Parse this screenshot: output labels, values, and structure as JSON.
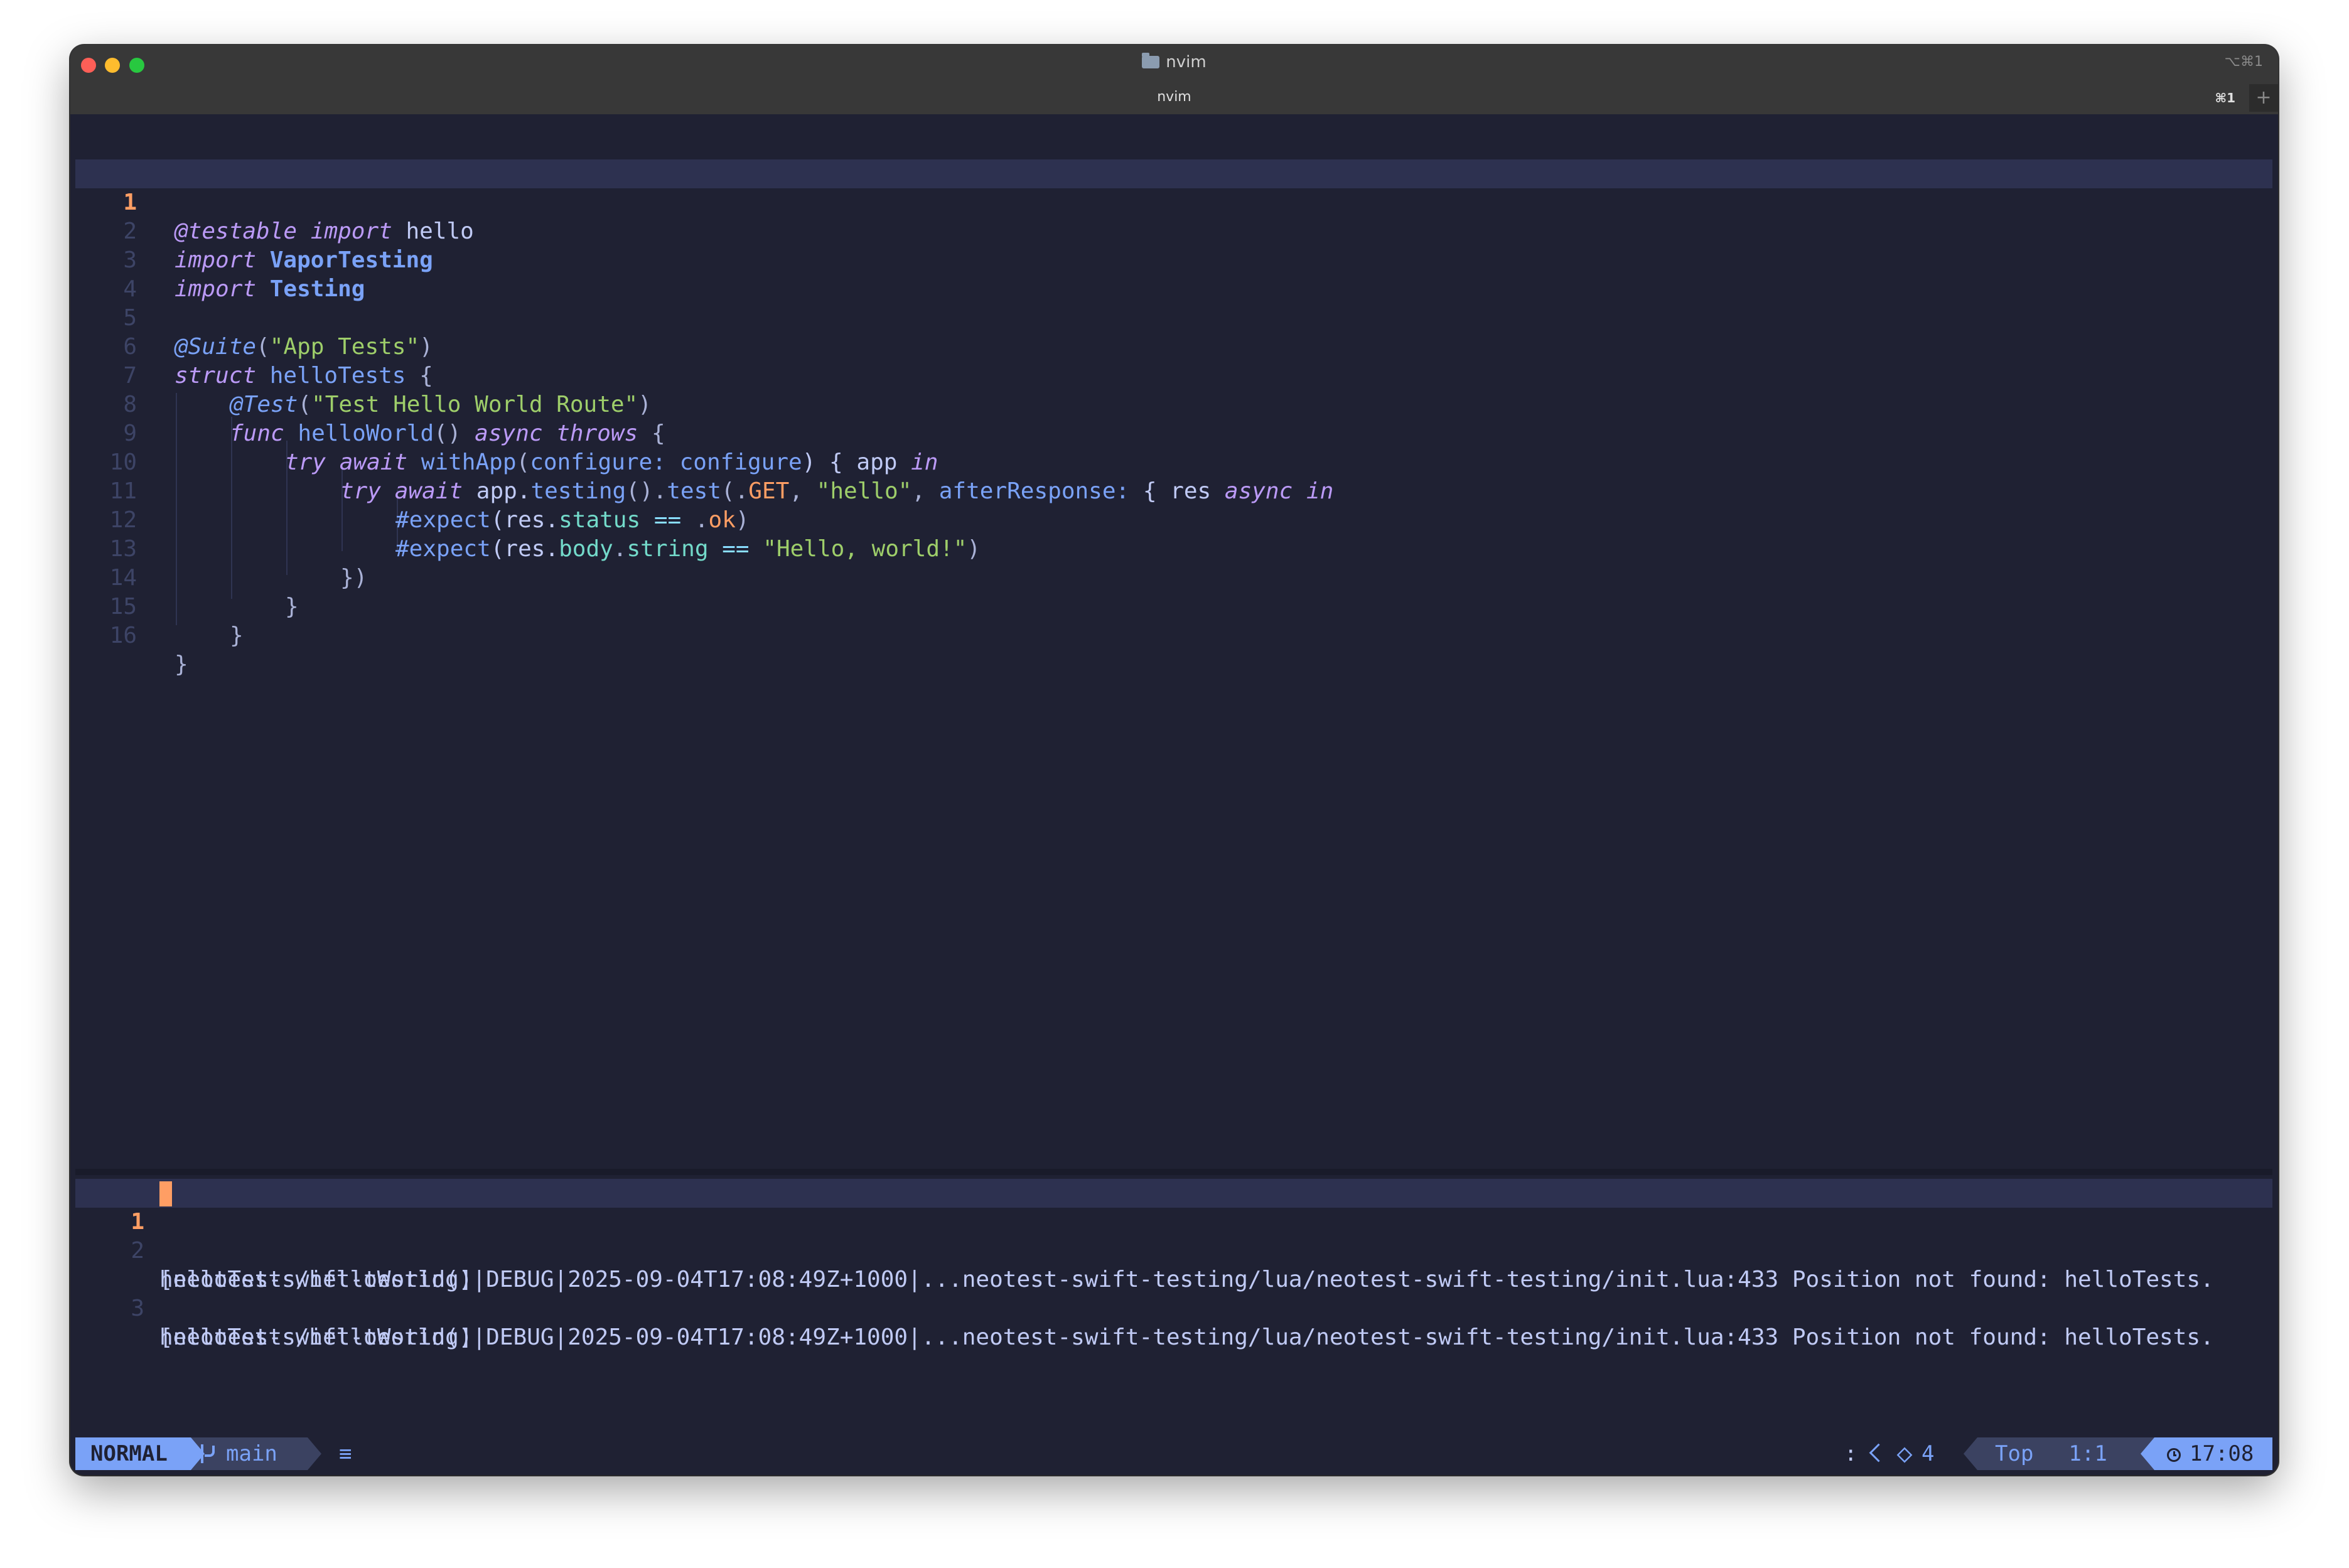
{
  "window": {
    "title": "nvim",
    "shortcut_top": "⌥⌘1",
    "tab": {
      "label": "nvim",
      "shortcut": "⌘1",
      "new_tab": "+"
    }
  },
  "editor": {
    "lines": [
      {
        "num": "1",
        "current": true
      },
      {
        "num": "2"
      },
      {
        "num": "3"
      },
      {
        "num": "4"
      },
      {
        "num": "5"
      },
      {
        "num": "6"
      },
      {
        "num": "7"
      },
      {
        "num": "8"
      },
      {
        "num": "9"
      },
      {
        "num": "10"
      },
      {
        "num": "11"
      },
      {
        "num": "12"
      },
      {
        "num": "13"
      },
      {
        "num": "14"
      },
      {
        "num": "15"
      },
      {
        "num": "16"
      }
    ],
    "tokens": {
      "l1": [
        "@testable",
        " ",
        "import",
        " hello"
      ],
      "l2": [
        "import",
        " ",
        "VaporTesting"
      ],
      "l3": [
        "import",
        " ",
        "Testing"
      ],
      "l5": [
        "@Suite",
        "(",
        "\"App Tests\"",
        ")"
      ],
      "l6": [
        "struct",
        " ",
        "helloTests",
        " {"
      ],
      "l7": [
        "@Test",
        "(",
        "\"Test Hello World Route\"",
        ")"
      ],
      "l8": [
        "func",
        " ",
        "helloWorld",
        "() ",
        "async",
        " ",
        "throws",
        " {"
      ],
      "l9": [
        "try",
        " ",
        "await",
        " ",
        "withApp",
        "(",
        "configure:",
        " ",
        "configure",
        ") { app ",
        "in"
      ],
      "l10": [
        "try",
        " ",
        "await",
        " app.",
        "testing",
        "().",
        "test",
        "(.",
        "GET",
        ", ",
        "\"hello\"",
        ", ",
        "afterResponse:",
        " { res ",
        "async",
        " ",
        "in"
      ],
      "l11": [
        "#expect",
        "(res.",
        "status",
        " ",
        "==",
        " .",
        "ok",
        ")"
      ],
      "l12": [
        "#expect",
        "(res.",
        "body",
        ".",
        "string",
        " ",
        "==",
        " ",
        "\"Hello, world!\"",
        ")"
      ],
      "l13": [
        "})"
      ],
      "l14": [
        "}"
      ],
      "l15": [
        "}"
      ],
      "l16": [
        "}"
      ]
    }
  },
  "log": {
    "lines": [
      {
        "num": "1",
        "text": "",
        "current": true
      },
      {
        "num": "2",
        "text": "[neotest-swift-testing]|DEBUG|2025-09-04T17:08:49Z+1000|...neotest-swift-testing/lua/neotest-swift-testing/init.lua:433 Position not found: helloTests.",
        "wrap": "helloTests/helloWorld()"
      },
      {
        "num": "3",
        "text": "[neotest-swift-testing]|DEBUG|2025-09-04T17:08:49Z+1000|...neotest-swift-testing/lua/neotest-swift-testing/init.lua:433 Position not found: helloTests.",
        "wrap": "helloTests/helloWorld()"
      }
    ]
  },
  "statusline": {
    "mode": "NORMAL",
    "branch": "main",
    "lines_icon": "≡",
    "colon": ":",
    "lsp_count": "4",
    "position": "Top",
    "cursor": "1:1",
    "time": "17:08"
  },
  "colors": {
    "bg": "#1f2133",
    "accent": "#7aa2f7",
    "keyword": "#bb9af7",
    "string": "#9ece6a",
    "orange": "#ff9e64"
  }
}
